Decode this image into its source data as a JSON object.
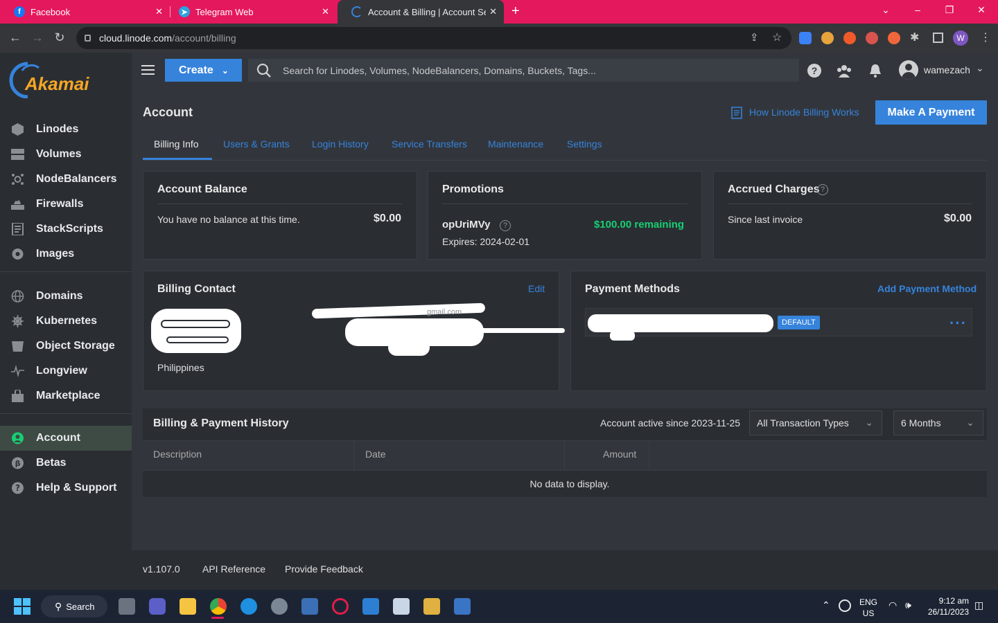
{
  "browser": {
    "tabs": [
      {
        "title": "Facebook",
        "icon": "facebook-icon"
      },
      {
        "title": "Telegram Web",
        "icon": "telegram-icon"
      },
      {
        "title": "Account & Billing | Account Sett",
        "icon": "akamai-icon"
      }
    ],
    "url_host": "cloud.linode.com",
    "url_path": "/account/billing",
    "profile_initial": "W",
    "accent": "#e4185d"
  },
  "brand": {
    "logo_text": "Akamai"
  },
  "header": {
    "create_label": "Create",
    "search_placeholder": "Search for Linodes, Volumes, NodeBalancers, Domains, Buckets, Tags...",
    "username": "wamezach"
  },
  "sidebar": {
    "group1": [
      {
        "label": "Linodes",
        "icon": "linode-hexagon-icon"
      },
      {
        "label": "Volumes",
        "icon": "volumes-icon"
      },
      {
        "label": "NodeBalancers",
        "icon": "nodebalancer-icon"
      },
      {
        "label": "Firewalls",
        "icon": "firewall-icon"
      },
      {
        "label": "StackScripts",
        "icon": "stackscripts-icon"
      },
      {
        "label": "Images",
        "icon": "images-icon"
      }
    ],
    "group2": [
      {
        "label": "Domains",
        "icon": "globe-icon"
      },
      {
        "label": "Kubernetes",
        "icon": "kubernetes-icon"
      },
      {
        "label": "Object Storage",
        "icon": "bucket-icon"
      },
      {
        "label": "Longview",
        "icon": "pulse-icon"
      },
      {
        "label": "Marketplace",
        "icon": "marketplace-icon"
      }
    ],
    "group3": [
      {
        "label": "Account",
        "icon": "account-icon",
        "active": true
      },
      {
        "label": "Betas",
        "icon": "beta-icon"
      },
      {
        "label": "Help & Support",
        "icon": "help-icon"
      }
    ]
  },
  "page": {
    "title": "Account",
    "billing_link": "How Linode Billing Works",
    "payment_button": "Make A Payment",
    "tabs": [
      "Billing Info",
      "Users & Grants",
      "Login History",
      "Service Transfers",
      "Maintenance",
      "Settings"
    ]
  },
  "balance": {
    "title": "Account Balance",
    "text": "You have no balance at this time.",
    "amount": "$0.00"
  },
  "promotions": {
    "title": "Promotions",
    "code": "opUriMVy",
    "remaining": "$100.00 remaining",
    "expires": "Expires: 2024-02-01"
  },
  "accrued": {
    "title": "Accrued Charges",
    "label": "Since last invoice",
    "amount": "$0.00"
  },
  "billing_contact": {
    "title": "Billing Contact",
    "edit": "Edit",
    "country": "Philippines",
    "email_fragment": "gmail.com"
  },
  "payment_methods": {
    "title": "Payment Methods",
    "add": "Add Payment Method",
    "default_badge": "DEFAULT"
  },
  "history": {
    "title": "Billing & Payment History",
    "active_since": "Account active since 2023-11-25",
    "type_filter": "All Transaction Types",
    "range_filter": "6 Months",
    "columns": [
      "Description",
      "Date",
      "Amount"
    ],
    "empty": "No data to display."
  },
  "footer": {
    "version": "v1.107.0",
    "api": "API Reference",
    "feedback": "Provide Feedback"
  },
  "taskbar": {
    "search": "Search",
    "lang1": "ENG",
    "lang2": "US",
    "time": "9:12 am",
    "date": "26/11/2023"
  }
}
